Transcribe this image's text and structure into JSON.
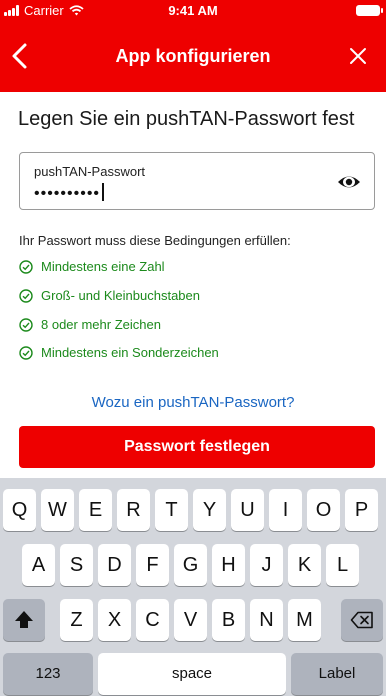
{
  "status": {
    "carrier": "Carrier",
    "time": "9:41 AM"
  },
  "nav": {
    "title": "App konfigurieren",
    "back_icon": "chevron-left-icon",
    "close_icon": "close-icon"
  },
  "heading": "Legen Sie ein pushTAN-Passwort fest",
  "password_field": {
    "label": "pushTAN-Passwort",
    "value": "••••••••••",
    "visibility_icon": "eye-icon"
  },
  "rules": {
    "title": "Ihr Passwort muss diese Bedingungen erfüllen:",
    "items": [
      {
        "label": "Mindestens eine Zahl",
        "icon": "check-circle-icon"
      },
      {
        "label": "Groß- und Kleinbuchstaben",
        "icon": "check-circle-icon"
      },
      {
        "label": "8 oder mehr Zeichen",
        "icon": "check-circle-icon"
      },
      {
        "label": "Mindestens ein Sonderzeichen",
        "icon": "check-circle-icon"
      }
    ]
  },
  "info_link": "Wozu ein pushTAN-Passwort?",
  "cta": "Passwort festlegen",
  "keyboard": {
    "row1": [
      "Q",
      "W",
      "E",
      "R",
      "T",
      "Y",
      "U",
      "I",
      "O",
      "P"
    ],
    "row2": [
      "A",
      "S",
      "D",
      "F",
      "G",
      "H",
      "J",
      "K",
      "L"
    ],
    "row3": [
      "Z",
      "X",
      "C",
      "V",
      "B",
      "N",
      "M"
    ],
    "numbers": "123",
    "space": "space",
    "return": "Label"
  },
  "colors": {
    "brand_red": "#ee0000",
    "success_green": "#1c8a1c",
    "link_blue": "#1a66c2"
  }
}
